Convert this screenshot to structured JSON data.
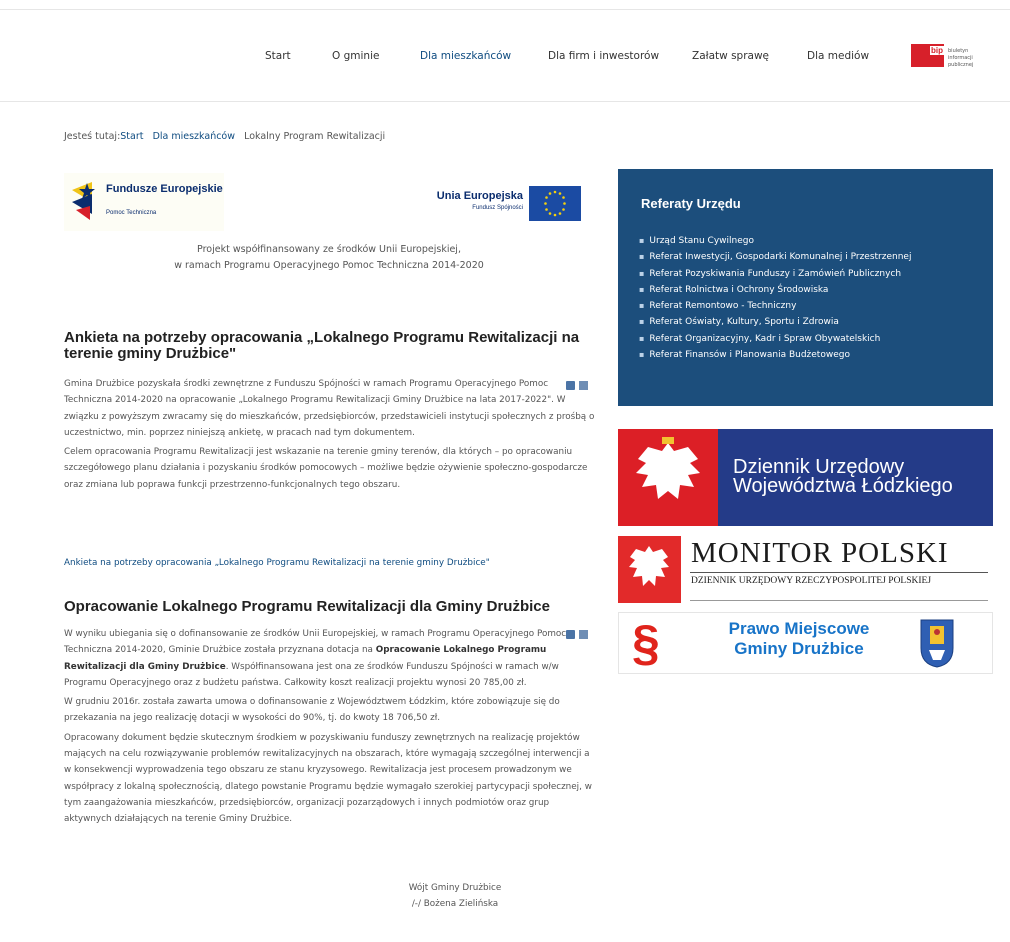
{
  "nav": {
    "items": [
      {
        "label": "Start"
      },
      {
        "label": "O gminie"
      },
      {
        "label": "Dla mieszkańców"
      },
      {
        "label": "Dla firm i inwestorów"
      },
      {
        "label": "Załatw sprawę"
      },
      {
        "label": "Dla mediów"
      }
    ],
    "bip": {
      "word": "bip",
      "text": "biuletyn informacji publicznej"
    }
  },
  "breadcrumb": {
    "prefix": "Jesteś tutaj:",
    "items": [
      "Start",
      "Dla mieszkańców",
      "Lokalny Program Rewitalizacji"
    ]
  },
  "logos": {
    "fe_title": "Fundusze Europejskie",
    "fe_sub": "Pomoc Techniczna",
    "ue_title": "Unia Europejska",
    "ue_sub": "Fundusz Spójności"
  },
  "cofinance": {
    "line1": "Projekt współfinansowany ze środków Unii Europejskiej,",
    "line2": "w ramach Programu Operacyjnego Pomoc Techniczna 2014-2020"
  },
  "article1": {
    "title": "Ankieta na potrzeby opracowania „Lokalnego Programu Rewitalizacji na terenie gminy Drużbice\"",
    "p1": "Gmina Drużbice pozyskała środki zewnętrzne z Funduszu Spójności w ramach  Programu Operacyjnego Pomoc Techniczna 2014-2020 na opracowanie „Lokalnego Programu Rewitalizacji Gminy Drużbice na lata 2017-2022\". W związku z powyższym zwracamy się do mieszkańców, przedsiębiorców, przedstawicieli instytucji społecznych z prośbą o uczestnictwo, min. poprzez niniejszą ankietę, w pracach nad tym dokumentem.",
    "p2": "Celem opracowania Programu Rewitalizacji jest wskazanie na terenie gminy terenów, dla których – po opracowaniu szczegółowego planu działania i pozyskaniu środków pomocowych – możliwe będzie ożywienie społeczno-gospodarcze oraz zmiana lub poprawa funkcji przestrzenno-funkcjonalnych tego obszaru.",
    "link": "Ankieta na potrzeby opracowania „Lokalnego Programu Rewitalizacji na terenie gminy Drużbice\""
  },
  "article2": {
    "title": "Opracowanie Lokalnego Programu Rewitalizacji dla Gminy Drużbice",
    "p1_a": "W wyniku ubiegania się o dofinansowanie ze środków Unii Europejskiej, w ramach Programu Operacyjnego Pomoc Techniczna 2014-2020, Gminie Drużbice została przyznana dotacja na ",
    "p1_bold": "Opracowanie Lokalnego Programu Rewitalizacji dla Gminy Drużbice",
    "p1_b": ". Współfinansowana jest ona ze środków Funduszu Spójności w ramach w/w Programu Operacyjnego oraz z budżetu państwa. Całkowity koszt realizacji projektu wynosi 20 785,00 zł.",
    "p2": "W grudniu 2016r. została zawarta umowa o dofinansowanie z Województwem Łódzkim, które zobowiązuje się do przekazania na jego realizację dotacji w wysokości do 90%, tj. do kwoty 18 706,50 zł.",
    "p3": "Opracowany dokument będzie skutecznym środkiem w pozyskiwaniu funduszy zewnętrznych na realizację projektów mających na celu rozwiązywanie problemów rewitalizacyjnych na obszarach, które wymagają szczególnej interwencji a w konsekwencji wyprowadzenia tego obszaru ze stanu kryzysowego. Rewitalizacja jest procesem prowadzonym we współpracy z lokalną społecznością, dlatego powstanie Programu będzie wymagało szerokiej partycypacji społecznej, w tym zaangażowania mieszkańców, przedsiębiorców, organizacji pozarządowych i innych podmiotów oraz grup aktywnych działających na terenie Gminy Drużbice.",
    "sig1": "Wójt Gminy Drużbice",
    "sig2": "/-/ Bożena Zielińska"
  },
  "sidebar": {
    "title": "Referaty Urzędu",
    "items": [
      "Urząd Stanu Cywilnego",
      "Referat Inwestycji, Gospodarki Komunalnej i Przestrzennej",
      "Referat Pozyskiwania Funduszy i Zamówień Publicznych",
      "Referat Rolnictwa i Ochrony Środowiska",
      "Referat Remontowo - Techniczny",
      "Referat Oświaty, Kultury, Sportu i Zdrowia",
      "Referat Organizacyjny, Kadr i Spraw Obywatelskich",
      "Referat Finansów i Planowania Budżetowego"
    ],
    "banner_dz": {
      "line1": "Dziennik Urzędowy",
      "line2": "Województwa Łódzkiego"
    },
    "banner_mp": {
      "title": "MONITOR  POLSKI",
      "sub": "DZIENNIK URZĘDOWY RZECZYPOSPOLITEJ POLSKIEJ"
    },
    "banner_pm": {
      "symbol": "§",
      "line1": "Prawo Miejscowe",
      "line2": "Gminy Drużbice"
    }
  },
  "colors": {
    "accent": "#0f4c81",
    "sidebar_bg": "#1c4e7c",
    "banner_dz_bg": "#243b88",
    "bip_red": "#d7202a"
  }
}
